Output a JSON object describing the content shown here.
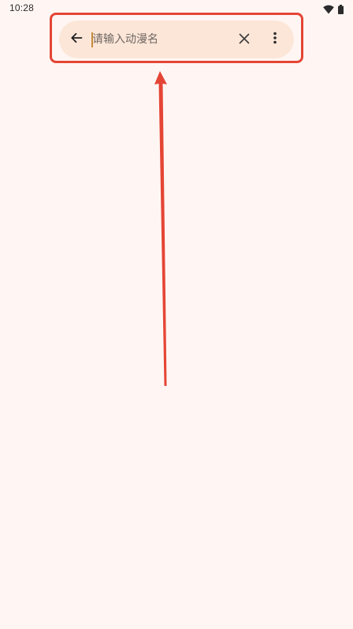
{
  "status_bar": {
    "time": "10:28",
    "icons": [
      "wifi-icon",
      "battery-icon"
    ]
  },
  "search": {
    "back_icon": "arrow-back-icon",
    "placeholder": "请输入动漫名",
    "value": "",
    "clear_icon": "close-icon",
    "more_icon": "more-vert-icon"
  },
  "annotation": {
    "type": "red-highlight-box-with-arrow",
    "color": "#E54535"
  },
  "colors": {
    "background": "#FFF6F3",
    "search_bar": "#FCE6D8",
    "caret": "#C58B3A",
    "annotation": "#E54535"
  }
}
